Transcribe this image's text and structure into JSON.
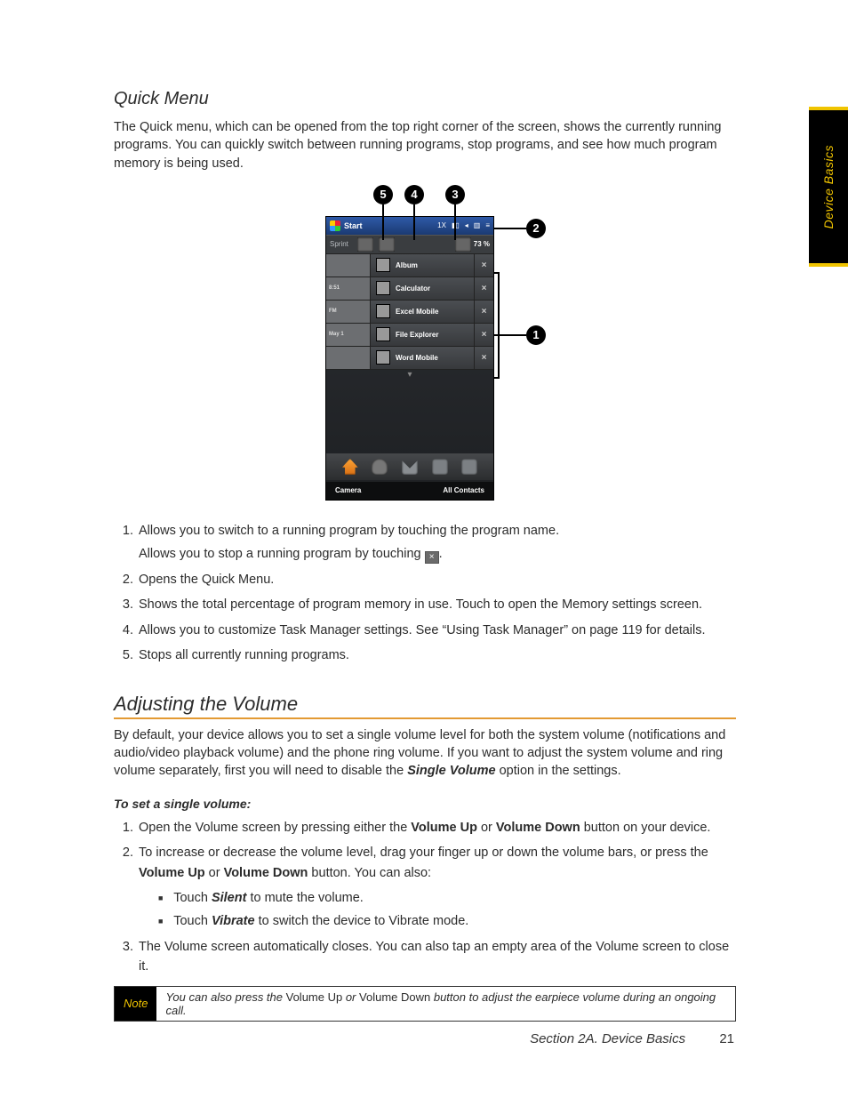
{
  "sideTab": "Device Basics",
  "quickMenu": {
    "heading": "Quick Menu",
    "para": "The Quick menu, which can be opened from the top right corner of the screen, shows the currently running programs. You can quickly switch between running programs, stop programs, and see how much program memory is being used.",
    "callouts": {
      "c1": "1",
      "c2": "2",
      "c3": "3",
      "c4": "4",
      "c5": "5"
    },
    "phone": {
      "start": "Start",
      "statusIcons": [
        "1X",
        "▮▯",
        "◂",
        "▥",
        "≡"
      ],
      "carrier": "Sprint",
      "memory": "73 %",
      "apps": [
        {
          "slice": "",
          "label": "Album",
          "iconClass": "ic-blue"
        },
        {
          "slice": "8:51",
          "label": "Calculator",
          "iconClass": "ic-calc"
        },
        {
          "slice": "FM",
          "label": "Excel Mobile",
          "iconClass": "ic-excel"
        },
        {
          "slice": "May 1",
          "label": "File Explorer",
          "iconClass": "ic-folder"
        },
        {
          "slice": "",
          "label": "Word Mobile",
          "iconClass": "ic-word"
        }
      ],
      "soft": {
        "left": "Camera",
        "right": "All Contacts"
      }
    },
    "list": {
      "i1a": "Allows you to switch to a running program by touching the program name.",
      "i1b_pre": "Allows you to stop a running program by touching ",
      "i1b_post": ".",
      "i2": "Opens the Quick Menu.",
      "i3": "Shows the total percentage of program memory in use. Touch to open the Memory settings screen.",
      "i4": "Allows you to customize Task Manager settings. See “Using Task Manager” on page 119 for details.",
      "i5": "Stops all currently running programs."
    }
  },
  "volume": {
    "heading": "Adjusting the Volume",
    "para_pre": "By default, your device allows you to set a single volume level for both the system volume (notifications and audio/video playback volume) and the phone ring volume. If you want to adjust the system volume and ring volume separately, first you will need to disable the ",
    "para_em": "Single Volume",
    "para_post": " option in the settings.",
    "sub": "To set a single volume:",
    "steps": {
      "s1_a": "Open the Volume screen by pressing either the ",
      "s1_vu": "Volume Up",
      "s1_b": " or ",
      "s1_vd": "Volume Down",
      "s1_c": " button on your device.",
      "s2_a": "To increase or decrease the volume level, drag your finger up or down the volume bars, or press the ",
      "s2_vu": "Volume Up",
      "s2_b": " or ",
      "s2_vd": "Volume Down",
      "s2_c": " button. You can also:",
      "s2_b1_a": "Touch ",
      "s2_b1_em": "Silent",
      "s2_b1_b": " to mute the volume.",
      "s2_b2_a": "Touch ",
      "s2_b2_em": "Vibrate",
      "s2_b2_b": " to switch the device to Vibrate mode.",
      "s3": "The Volume screen automatically closes. You can also tap an empty area of the Volume screen to close it."
    },
    "note": {
      "tag": "Note",
      "a": "You can also press the ",
      "vu": "Volume Up",
      "b": " or ",
      "vd": "Volume Down",
      "c": " button to adjust the earpiece volume during an ongoing call."
    }
  },
  "footer": {
    "section": "Section 2A. Device Basics",
    "page": "21"
  }
}
